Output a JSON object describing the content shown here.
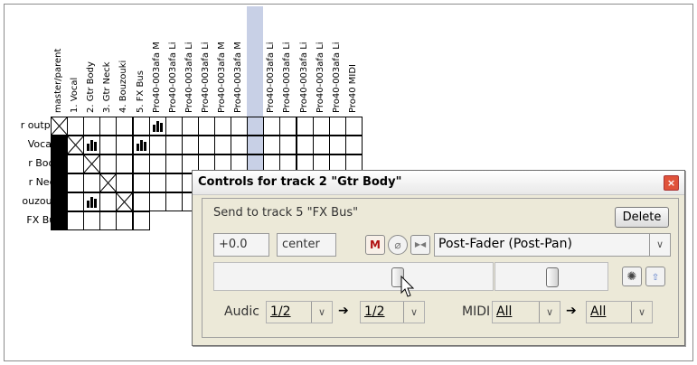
{
  "matrix": {
    "columns": [
      "master/parent",
      "1. Vocal",
      "2. Gtr Body",
      "3. Gtr Neck",
      "4. Bouzouki",
      "5. FX Bus",
      "Pro40-003afa M",
      "Pro40-003afa Li",
      "Pro40-003afa Li",
      "Pro40-003afa Li",
      "Pro40-003afa M",
      "Pro40-003afa M",
      "Pro40-003afa Li",
      "Pro40-003afa Li",
      "Pro40-003afa Li",
      "Pro40-003afa Li",
      "Pro40-003afa Li",
      "Pro40-003afa Li",
      "Pro40 MIDI"
    ],
    "rows": [
      "r output",
      ". Vocal",
      "r Body",
      "r Neck",
      "ouzouki",
      "FX Bus"
    ]
  },
  "dialog": {
    "title": "Controls for track 2 \"Gtr Body\"",
    "close_label": "×",
    "send_label": "Send to track 5 \"FX Bus\"",
    "delete_label": "Delete",
    "volume_value": "+0.0",
    "pan_value": "center",
    "mute_label": "M",
    "phase_label": "⌀",
    "mono_label": "▶◀",
    "mode_value": "Post-Fader (Post-Pan)",
    "audio_label": "Audic",
    "audio_src": "1/2",
    "audio_dst": "1/2",
    "midi_label": "MIDI",
    "midi_src": "All",
    "midi_dst": "All",
    "env_icon": "envelope-icon",
    "fx_icon": "fx-icon"
  }
}
